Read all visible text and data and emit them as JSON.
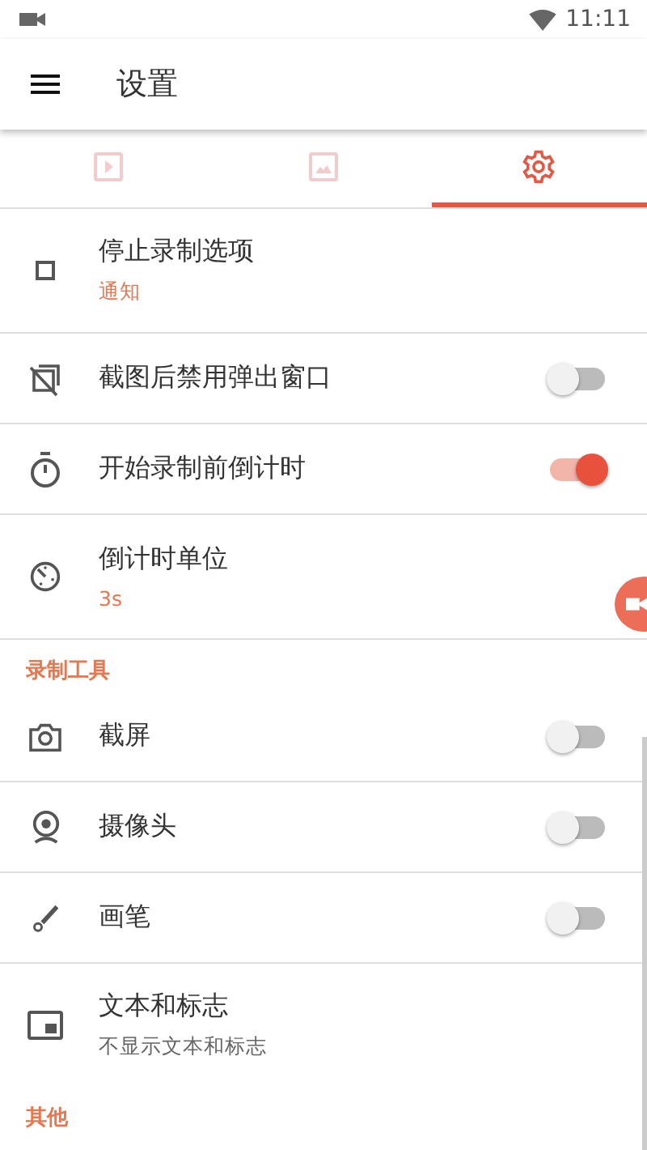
{
  "status_bar": {
    "time": "11:11"
  },
  "app_bar": {
    "title": "设置"
  },
  "tabs": [
    {
      "selected": false
    },
    {
      "selected": false
    },
    {
      "selected": true
    }
  ],
  "sections": [
    {
      "items": [
        {
          "kind": "value",
          "title": "停止录制选项",
          "subtitle": "通知",
          "accent": true
        },
        {
          "kind": "switch",
          "title": "截图后禁用弹出窗口",
          "on": false
        },
        {
          "kind": "switch",
          "title": "开始录制前倒计时",
          "on": true
        },
        {
          "kind": "value",
          "title": "倒计时单位",
          "subtitle": "3s",
          "accent": true
        }
      ]
    },
    {
      "header": "录制工具",
      "items": [
        {
          "kind": "switch",
          "title": "截屏",
          "on": false
        },
        {
          "kind": "switch",
          "title": "摄像头",
          "on": false
        },
        {
          "kind": "switch",
          "title": "画笔",
          "on": false
        },
        {
          "kind": "value",
          "title": "文本和标志",
          "subtitle": "不显示文本和标志",
          "accent": false
        }
      ]
    },
    {
      "header": "其他"
    }
  ]
}
